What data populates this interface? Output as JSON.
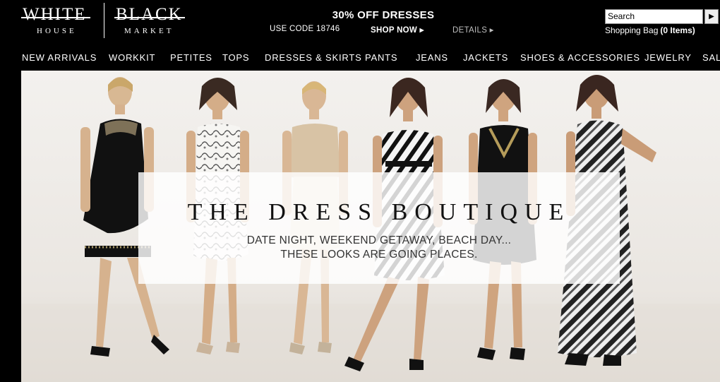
{
  "logo": {
    "word_left": "WHITE",
    "word_right": "BLACK",
    "sub_left": "HOUSE",
    "sub_right": "MARKET"
  },
  "promo": {
    "title": "30% OFF DRESSES",
    "code_text": "USE CODE 18746",
    "shop_now": "SHOP NOW ▸",
    "details": "DETAILS ▸"
  },
  "search": {
    "placeholder": "Search",
    "value": "Search",
    "go_icon": "play-arrow-icon",
    "go_glyph": "▶"
  },
  "bag": {
    "label": "Shopping Bag",
    "count": "(0 Items)"
  },
  "nav": {
    "items": [
      "NEW ARRIVALS",
      "WORKKIT",
      "PETITES",
      "TOPS",
      "DRESSES & SKIRTS",
      "PANTS",
      "JEANS",
      "JACKETS",
      "SHOES & ACCESSORIES",
      "JEWELRY",
      "SALE"
    ]
  },
  "hero": {
    "title": "THE DRESS BOUTIQUE",
    "subtitle_line1": "DATE NIGHT, WEEKEND GETAWAY, BEACH DAY...",
    "subtitle_line2": "THESE LOOKS ARE GOING PLACES."
  },
  "colors": {
    "background": "#000000",
    "text": "#ffffff",
    "details": "#bfbfbf",
    "hero_bg": "#eeebe7"
  }
}
